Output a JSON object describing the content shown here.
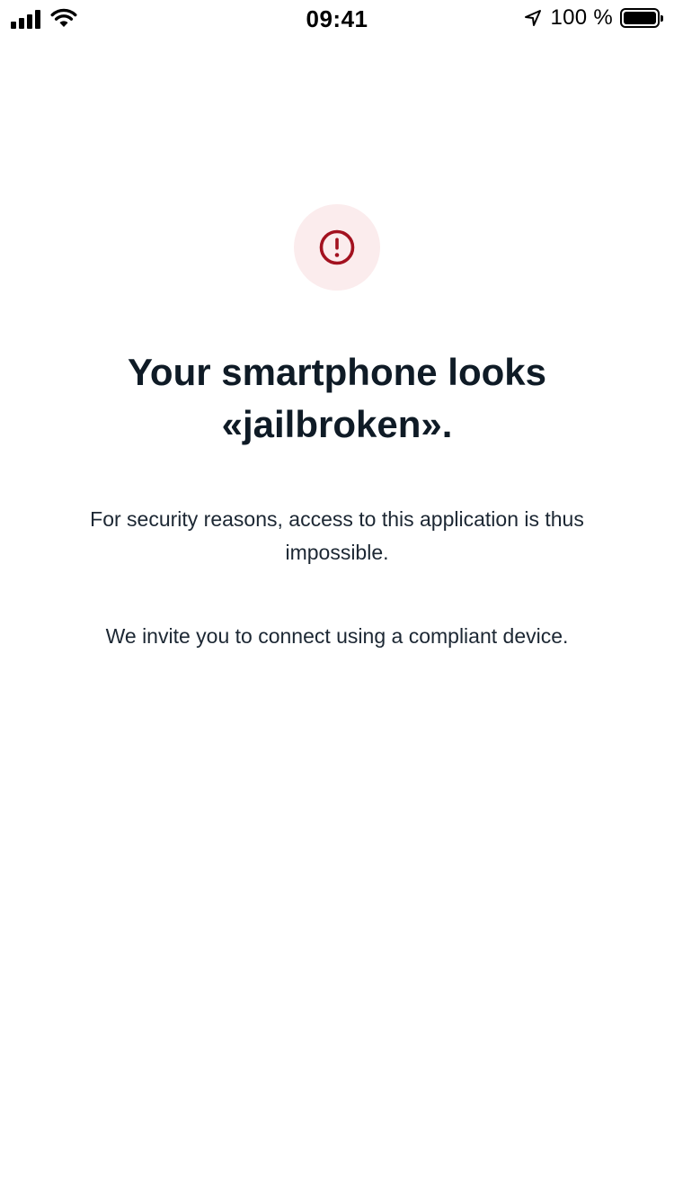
{
  "status_bar": {
    "time": "09:41",
    "battery_percent": "100 %",
    "battery_level": 1.0,
    "icons": [
      "signal-icon",
      "wifi-icon",
      "location-arrow-icon",
      "battery-icon"
    ]
  },
  "alert": {
    "icon": "exclamation-circle-icon",
    "icon_color": "#a3111f",
    "background_color": "#fbeced"
  },
  "title": {
    "line1": "Your smartphone looks",
    "line2": "«jailbroken»."
  },
  "messages": {
    "security": "For security reasons, access to this application is thus impossible.",
    "invite": "We invite you to connect using a compliant device."
  },
  "colors": {
    "text_primary": "#0f1b26",
    "background": "#ffffff"
  }
}
